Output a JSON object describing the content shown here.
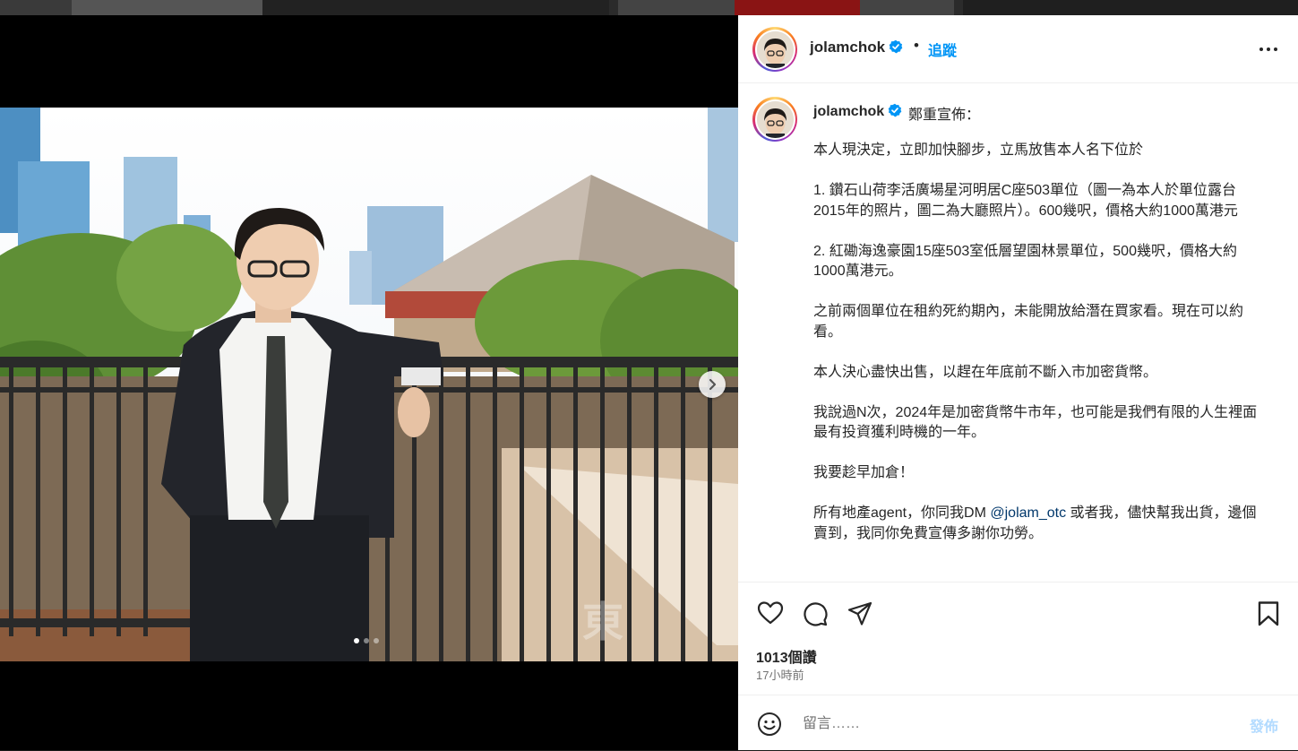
{
  "post": {
    "username": "jolamchok",
    "separator": "•",
    "follow_label": "追蹤",
    "verified_icon": "verified-badge-icon",
    "caption_heading": "鄭重宣佈：",
    "caption_paragraphs": [
      "本人現決定，立即加快腳步，立馬放售本人名下位於",
      "1. 鑽石山荷李活廣場星河明居C座503單位（圖一為本人於單位露台2015年的照片，圖二為大廳照片）。600幾呎，價格大約1000萬港元",
      "2. 紅磡海逸豪園15座503室低層望園林景單位，500幾呎，價格大約1000萬港元。",
      "之前兩個單位在租約死約期內，未能開放給潛在買家看。現在可以約看。",
      "本人決心盡快出售，以趕在年底前不斷入市加密貨幣。",
      "我說過N次，2024年是加密貨幣牛市年，也可能是我們有限的人生裡面最有投資獲利時機的一年。",
      "我要趁早加倉！"
    ],
    "last_paragraph": {
      "before": "所有地產agent，你同我DM ",
      "mention": "@jolam_otc",
      "after": " 或者我，儘快幫我出貨，邊個賣到，我同你免費宣傳多謝你功勞。"
    },
    "likes": "1013個讚",
    "timestamp": "17小時前",
    "comment_placeholder": "留言……",
    "post_button": "發佈"
  },
  "carousel": {
    "total": 3,
    "current": 1
  },
  "colors": {
    "link_blue": "#0095f6",
    "mention_blue": "#00376b",
    "post_disabled": "#b3dbff",
    "text": "#262626",
    "muted": "#737373"
  },
  "icons": {
    "like": "heart-icon",
    "comment": "comment-icon",
    "share": "share-icon",
    "save": "bookmark-icon",
    "more": "more-options-icon",
    "next": "chevron-right-icon",
    "emoji": "emoji-icon"
  }
}
